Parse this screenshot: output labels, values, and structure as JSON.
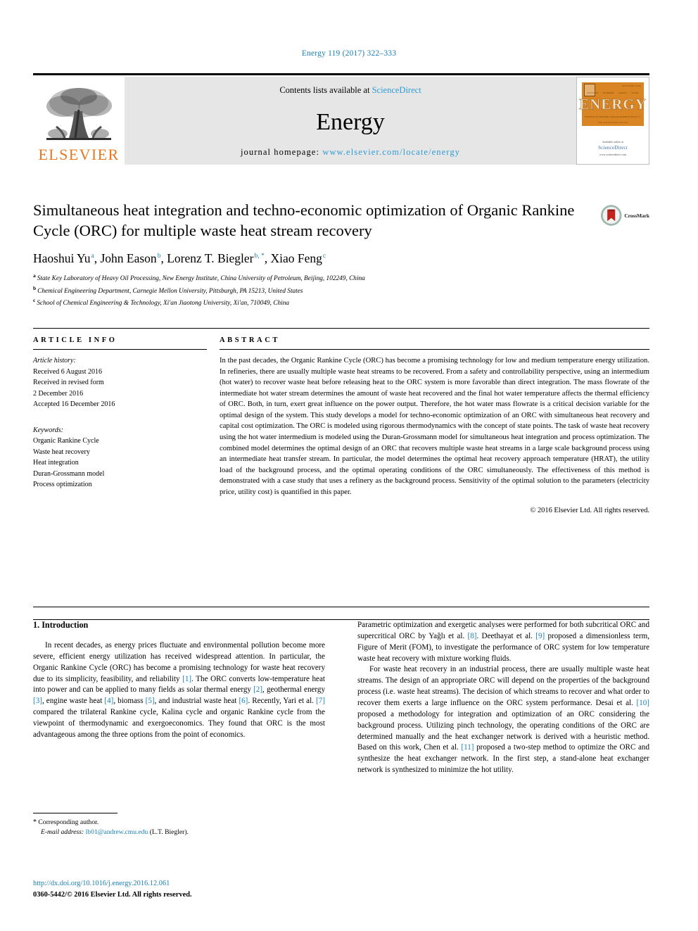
{
  "running_head": "Energy 119 (2017) 322–333",
  "masthead": {
    "publisher_name": "ELSEVIER",
    "contents_prefix": "Contents lists available at ",
    "contents_link": "ScienceDirect",
    "journal_name": "Energy",
    "homepage_prefix": "journal homepage: ",
    "homepage_url": "www.elsevier.com/locate/energy",
    "cover_title": "ENERGY",
    "cover_subtitle": "The International Journal",
    "cover_footer_label": "Available online at",
    "cover_footer_brand": "ScienceDirect",
    "cover_footer_url": "www.sciencedirect.com"
  },
  "article": {
    "title": "Simultaneous heat integration and techno-economic optimization of Organic Rankine Cycle (ORC) for multiple waste heat stream recovery",
    "crossmark_label": "CrossMark",
    "authors": [
      {
        "name": "Haoshui Yu",
        "marks": "a"
      },
      {
        "name": "John Eason",
        "marks": "b"
      },
      {
        "name": "Lorenz T. Biegler",
        "marks": "b, *"
      },
      {
        "name": "Xiao Feng",
        "marks": "c"
      }
    ],
    "affiliations": [
      {
        "mark": "a",
        "text": "State Key Laboratory of Heavy Oil Processing, New Energy Institute, China University of Petroleum, Beijing, 102249, China"
      },
      {
        "mark": "b",
        "text": "Chemical Engineering Department, Carnegie Mellon University, Pittsburgh, PA 15213, United States"
      },
      {
        "mark": "c",
        "text": "School of Chemical Engineering & Technology, Xi'an Jiaotong University, Xi'an, 710049, China"
      }
    ]
  },
  "article_info": {
    "heading": "ARTICLE INFO",
    "history_label": "Article history:",
    "history": [
      "Received 6 August 2016",
      "Received in revised form",
      "2 December 2016",
      "Accepted 16 December 2016"
    ],
    "keywords_label": "Keywords:",
    "keywords": [
      "Organic Rankine Cycle",
      "Waste heat recovery",
      "Heat integration",
      "Duran-Grossmann model",
      "Process optimization"
    ]
  },
  "abstract": {
    "heading": "ABSTRACT",
    "text": "In the past decades, the Organic Rankine Cycle (ORC) has become a promising technology for low and medium temperature energy utilization. In refineries, there are usually multiple waste heat streams to be recovered. From a safety and controllability perspective, using an intermedium (hot water) to recover waste heat before releasing heat to the ORC system is more favorable than direct integration. The mass flowrate of the intermediate hot water stream determines the amount of waste heat recovered and the final hot water temperature affects the thermal efficiency of ORC. Both, in turn, exert great influence on the power output. Therefore, the hot water mass flowrate is a critical decision variable for the optimal design of the system. This study develops a model for techno-economic optimization of an ORC with simultaneous heat recovery and capital cost optimization. The ORC is modeled using rigorous thermodynamics with the concept of state points. The task of waste heat recovery using the hot water intermedium is modeled using the Duran-Grossmann model for simultaneous heat integration and process optimization. The combined model determines the optimal design of an ORC that recovers multiple waste heat streams in a large scale background process using an intermediate heat transfer stream. In particular, the model determines the optimal heat recovery approach temperature (HRAT), the utility load of the background process, and the optimal operating conditions of the ORC simultaneously. The effectiveness of this method is demonstrated with a case study that uses a refinery as the background process. Sensitivity of the optimal solution to the parameters (electricity price, utility cost) is quantified in this paper.",
    "copyright": "© 2016 Elsevier Ltd. All rights reserved."
  },
  "introduction": {
    "section_number": "1.",
    "section_title": "Introduction",
    "left_paragraphs": [
      "In recent decades, as energy prices fluctuate and environmental pollution become more severe, efficient energy utilization has received widespread attention. In particular, the Organic Rankine Cycle (ORC) has become a promising technology for waste heat recovery due to its simplicity, feasibility, and reliability [1]. The ORC converts low-temperature heat into power and can be applied to many fields as solar thermal energy [2], geothermal energy [3], engine waste heat [4], biomass [5], and industrial waste heat [6]. Recently, Yari et al. [7] compared the trilateral Rankine cycle, Kalina cycle and organic Rankine cycle from the viewpoint of thermodynamic and exergoeconomics. They found that ORC is the most advantageous among the three options from the point of economics."
    ],
    "right_paragraphs": [
      "Parametric optimization and exergetic analyses were performed for both subcritical ORC and supercritical ORC by Yağlı et al. [8]. Deethayat et al. [9] proposed a dimensionless term, Figure of Merit (FOM), to investigate the performance of ORC system for low temperature waste heat recovery with mixture working fluids.",
      "For waste heat recovery in an industrial process, there are usually multiple waste heat streams. The design of an appropriate ORC will depend on the properties of the background process (i.e. waste heat streams). The decision of which streams to recover and what order to recover them exerts a large influence on the ORC system performance. Desai et al. [10] proposed a methodology for integration and optimization of an ORC considering the background process. Utilizing pinch technology, the operating conditions of the ORC are determined manually and the heat exchanger network is derived with a heuristic method. Based on this work, Chen et al. [11] proposed a two-step method to optimize the ORC and synthesize the heat exchanger network. In the first step, a stand-alone heat exchanger network is synthesized to minimize the hot utility."
    ]
  },
  "footnotes": {
    "corresponding_marker": "*",
    "corresponding_text": "Corresponding author.",
    "email_label": "E-mail address:",
    "email": "lb01@andrew.cmu.edu",
    "email_owner": "(L.T. Biegler)."
  },
  "imprint": {
    "doi": "http://dx.doi.org/10.1016/j.energy.2016.12.061",
    "issn_line": "0360-5442/© 2016 Elsevier Ltd. All rights reserved."
  },
  "colors": {
    "link_blue": "#1a7fb5",
    "sciencedirect_blue": "#2e9cd6",
    "elsevier_orange": "#E87722",
    "cover_orange": "#D98523"
  }
}
